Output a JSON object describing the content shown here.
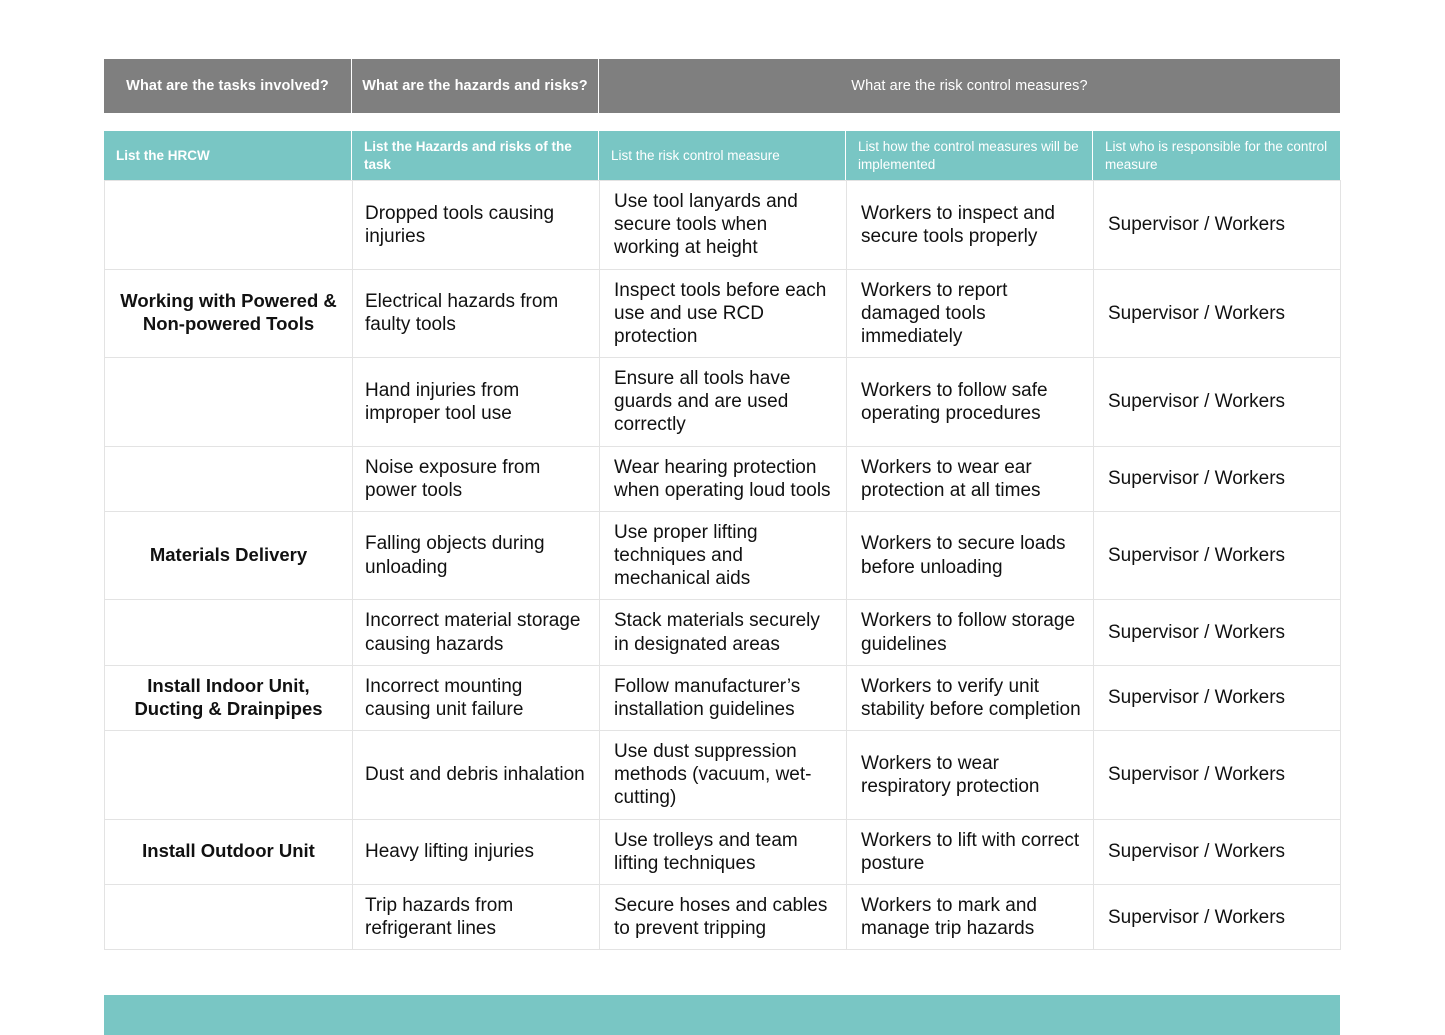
{
  "colors": {
    "group_header_bg": "#7f7f7f",
    "sub_header_bg": "#79c6c4",
    "grid_line": "#e3e3e3",
    "page_bg": "#ffffff",
    "text": "#111111"
  },
  "group_headers": [
    {
      "label": "What are the tasks involved?"
    },
    {
      "label": "What are the hazards and risks?"
    },
    {
      "label": "What are the risk control measures?"
    }
  ],
  "column_headers": [
    {
      "label": "List the HRCW"
    },
    {
      "label": "List the Hazards and risks of the task"
    },
    {
      "label": "List the risk control measure"
    },
    {
      "label": "List how the control measures will be implemented"
    },
    {
      "label": "List who is responsible for the control measure"
    }
  ],
  "rows": [
    {
      "task": "",
      "hazard": "Dropped tools causing injuries",
      "control": "Use tool lanyards and secure tools when working at height",
      "implementation": "Workers to inspect and secure tools properly",
      "responsible": "Supervisor / Workers"
    },
    {
      "task": "Working with Powered & Non-powered Tools",
      "hazard": "Electrical hazards from faulty tools",
      "control": "Inspect tools before each use and use RCD protection",
      "implementation": "Workers to report damaged tools immediately",
      "responsible": "Supervisor / Workers"
    },
    {
      "task": "",
      "hazard": "Hand injuries from improper tool use",
      "control": "Ensure all tools have guards and are used correctly",
      "implementation": "Workers to follow safe operating procedures",
      "responsible": "Supervisor / Workers"
    },
    {
      "task": "",
      "hazard": "Noise exposure from power tools",
      "control": "Wear hearing protection when operating loud tools",
      "implementation": "Workers to wear ear protection at all times",
      "responsible": "Supervisor / Workers"
    },
    {
      "task": "Materials Delivery",
      "hazard": "Falling objects during unloading",
      "control": "Use proper lifting techniques and mechanical aids",
      "implementation": "Workers to secure loads before unloading",
      "responsible": "Supervisor / Workers"
    },
    {
      "task": "",
      "hazard": "Incorrect material storage causing hazards",
      "control": "Stack materials securely in designated areas",
      "implementation": "Workers to follow storage guidelines",
      "responsible": "Supervisor / Workers"
    },
    {
      "task": "Install Indoor Unit, Ducting & Drainpipes",
      "hazard": "Incorrect mounting causing unit failure",
      "control": "Follow manufacturer’s installation guidelines",
      "implementation": "Workers to verify unit stability before completion",
      "responsible": "Supervisor / Workers"
    },
    {
      "task": "",
      "hazard": "Dust and debris inhalation",
      "control": "Use dust suppression methods (vacuum, wet-cutting)",
      "implementation": "Workers to wear respiratory protection",
      "responsible": "Supervisor / Workers"
    },
    {
      "task": "Install Outdoor Unit",
      "hazard": "Heavy lifting injuries",
      "control": "Use trolleys and team lifting techniques",
      "implementation": "Workers to lift with correct posture",
      "responsible": "Supervisor / Workers"
    },
    {
      "task": "",
      "hazard": "Trip hazards from refrigerant lines",
      "control": "Secure hoses and cables to prevent tripping",
      "implementation": "Workers to mark and manage trip hazards",
      "responsible": "Supervisor / Workers"
    }
  ],
  "bottom_band": {
    "label": ""
  }
}
